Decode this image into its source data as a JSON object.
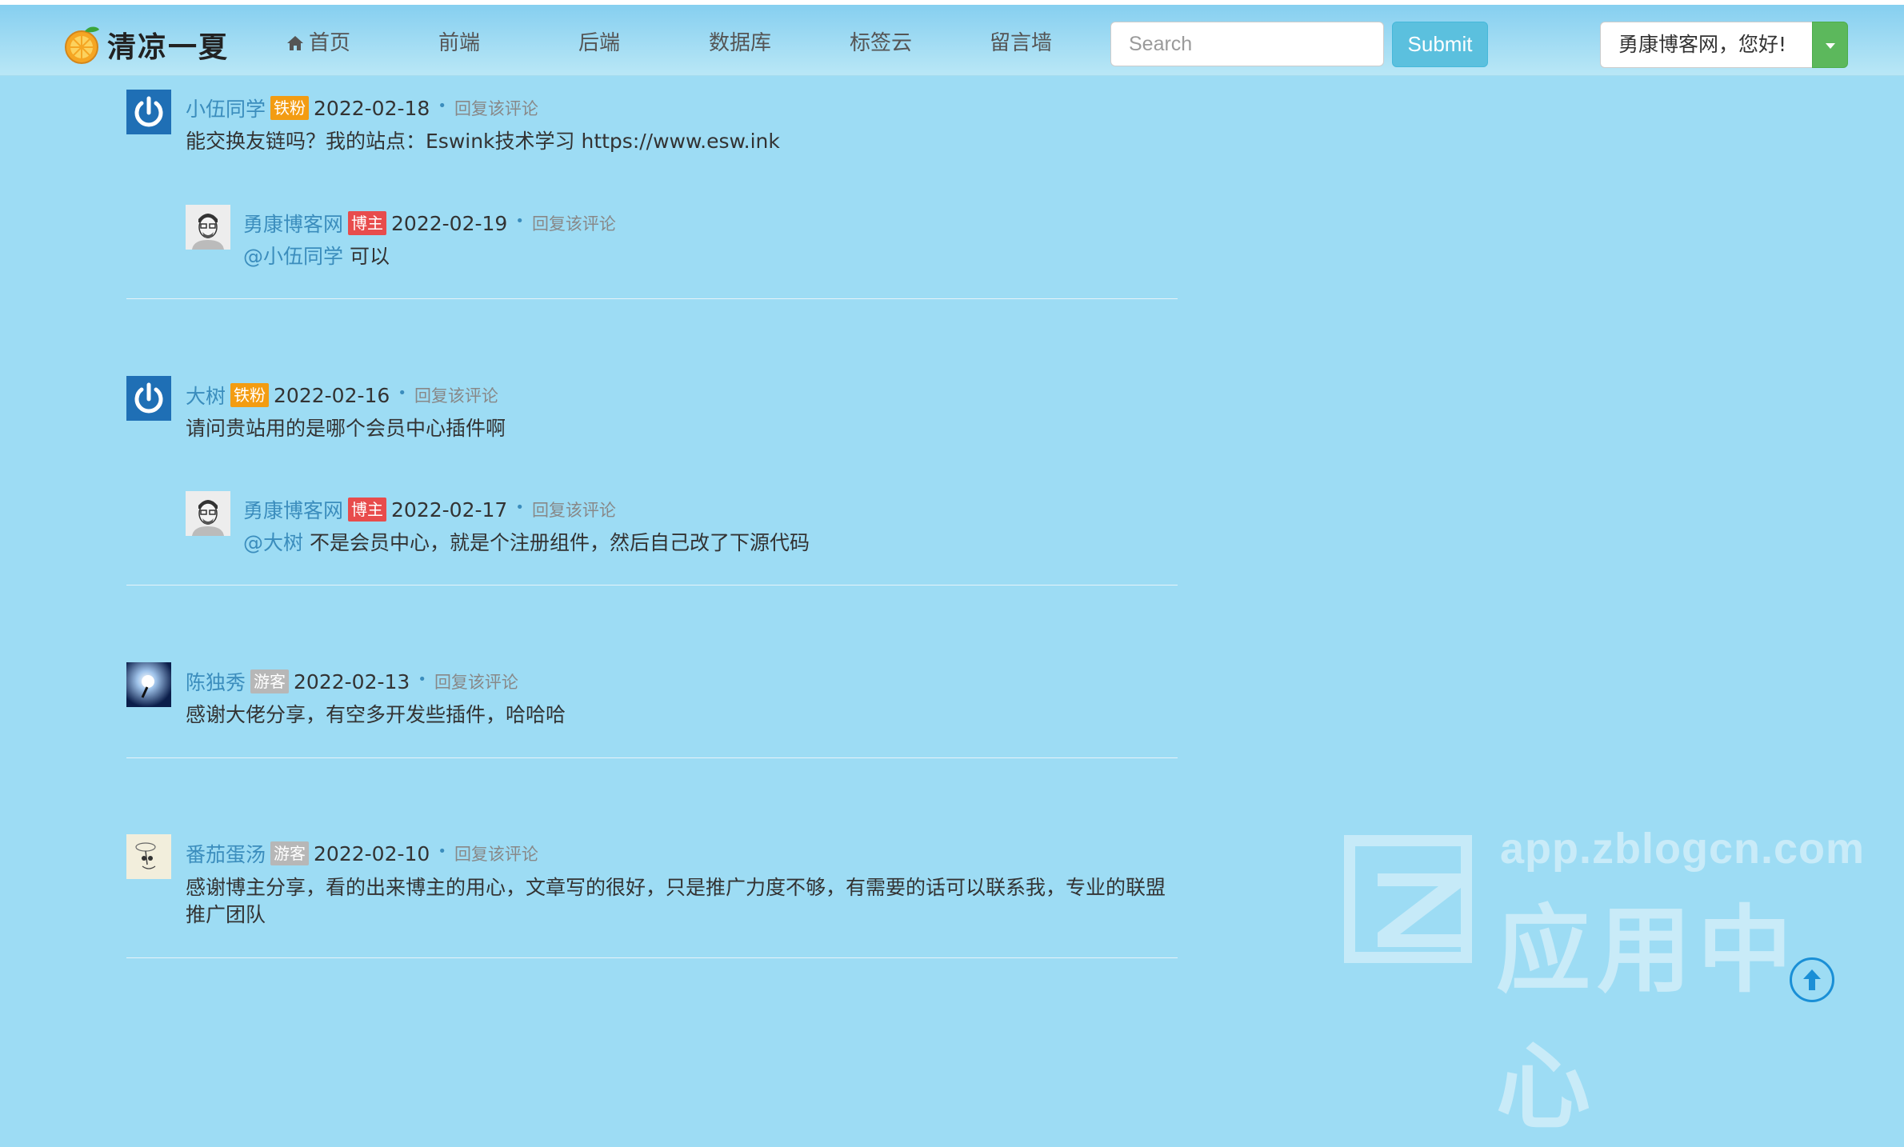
{
  "nav": {
    "logo_text": "清凉一夏",
    "items": [
      {
        "label": "首页",
        "icon": "home-icon"
      },
      {
        "label": "前端"
      },
      {
        "label": "后端"
      },
      {
        "label": "数据库"
      },
      {
        "label": "标签云"
      },
      {
        "label": "留言墙"
      }
    ],
    "search_placeholder": "Search",
    "submit_label": "Submit",
    "user_greeting": "勇康博客网，您好!"
  },
  "comments": [
    {
      "author": "小伍同学",
      "badge": "铁粉",
      "date": "2022-02-18",
      "reply_label": "回复该评论",
      "avatar": "power-avatar-icon",
      "text": "能交换友链吗？我的站点：Eswink技术学习 https://www.esw.ink",
      "reply": {
        "author": "勇康博客网",
        "badge": "博主",
        "date": "2022-02-19",
        "reply_label": "回复该评论",
        "avatar": "blogger-avatar-icon",
        "mention": "@小伍同学",
        "text": " 可以"
      }
    },
    {
      "author": "大树",
      "badge": "铁粉",
      "date": "2022-02-16",
      "reply_label": "回复该评论",
      "avatar": "power-avatar-icon",
      "text": "请问贵站用的是哪个会员中心插件啊",
      "reply": {
        "author": "勇康博客网",
        "badge": "博主",
        "date": "2022-02-17",
        "reply_label": "回复该评论",
        "avatar": "blogger-avatar-icon",
        "mention": "@大树",
        "text": " 不是会员中心，就是个注册组件，然后自己改了下源代码"
      }
    },
    {
      "author": "陈独秀",
      "badge": "游客",
      "date": "2022-02-13",
      "reply_label": "回复该评论",
      "avatar": "lightbulb-avatar-icon",
      "text": "感谢大佬分享，有空多开发些插件，哈哈哈"
    },
    {
      "author": "番茄蛋汤",
      "badge": "游客",
      "date": "2022-02-10",
      "reply_label": "回复该评论",
      "avatar": "sketch-avatar-icon",
      "text": "感谢博主分享，看的出来博主的用心，文章写的很好，只是推广力度不够，有需要的话可以联系我，专业的联盟推广团队"
    }
  ],
  "watermark": {
    "url": "app.zblogcn.com",
    "text": "应用中心"
  },
  "colors": {
    "background": "#9ddcf4",
    "link": "#3b8dbd",
    "submit": "#5bc0de",
    "caret": "#5cb85c",
    "badge_iron": "#f39c12",
    "badge_host": "#e84c4c",
    "badge_guest": "#b7b7b7"
  }
}
